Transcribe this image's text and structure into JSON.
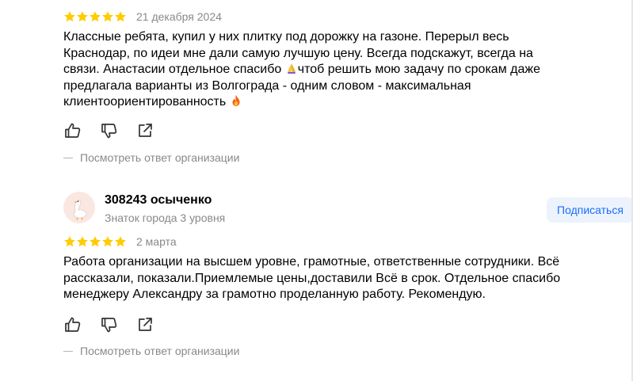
{
  "colors": {
    "star": "#fc0",
    "text": "#000000",
    "muted": "#898989",
    "subscribe_bg": "#edf3fc",
    "subscribe_text": "#196dff",
    "avatar_bg": "#fbe7e1"
  },
  "reviews": [
    {
      "rating": 5,
      "date": "21 декабря 2024",
      "text_before_emoji_1": "Классные ребята, купил у них плитку под дорожку на газоне. Перерыл весь Краснодар, по идеи мне дали самую лучшую цену. Всегда подскажут, всегда на связи. Анастасии отдельное спасибо ",
      "emoji_1": "praying-hands-emoji",
      "text_after_emoji_1": "чтоб решить мою задачу по срокам даже предлагала варианты из Волгограда - одним словом - максимальная клиентоориентированность ",
      "emoji_2": "fire-emoji",
      "actions": {
        "like_icon": "thumbs-up-icon",
        "dislike_icon": "thumbs-down-icon",
        "share_icon": "share-icon"
      },
      "org_reply_label": "Посмотреть ответ организации"
    },
    {
      "author": {
        "name": "308243 осыченко",
        "level": "Знаток города 3 уровня",
        "avatar_icon": "goose-avatar-icon",
        "subscribe_label": "Подписаться"
      },
      "rating": 5,
      "date": "2 марта",
      "text": "Работа организации на высшем уровне, грамотные, ответственные сотрудники. Всё рассказали, показали.Приемлемые цены,доставили Всё в срок. Отдельное спасибо менеджеру Александру за грамотно проделанную работу. Рекомендую.",
      "actions": {
        "like_icon": "thumbs-up-icon",
        "dislike_icon": "thumbs-down-icon",
        "share_icon": "share-icon"
      },
      "org_reply_label": "Посмотреть ответ организации"
    }
  ]
}
